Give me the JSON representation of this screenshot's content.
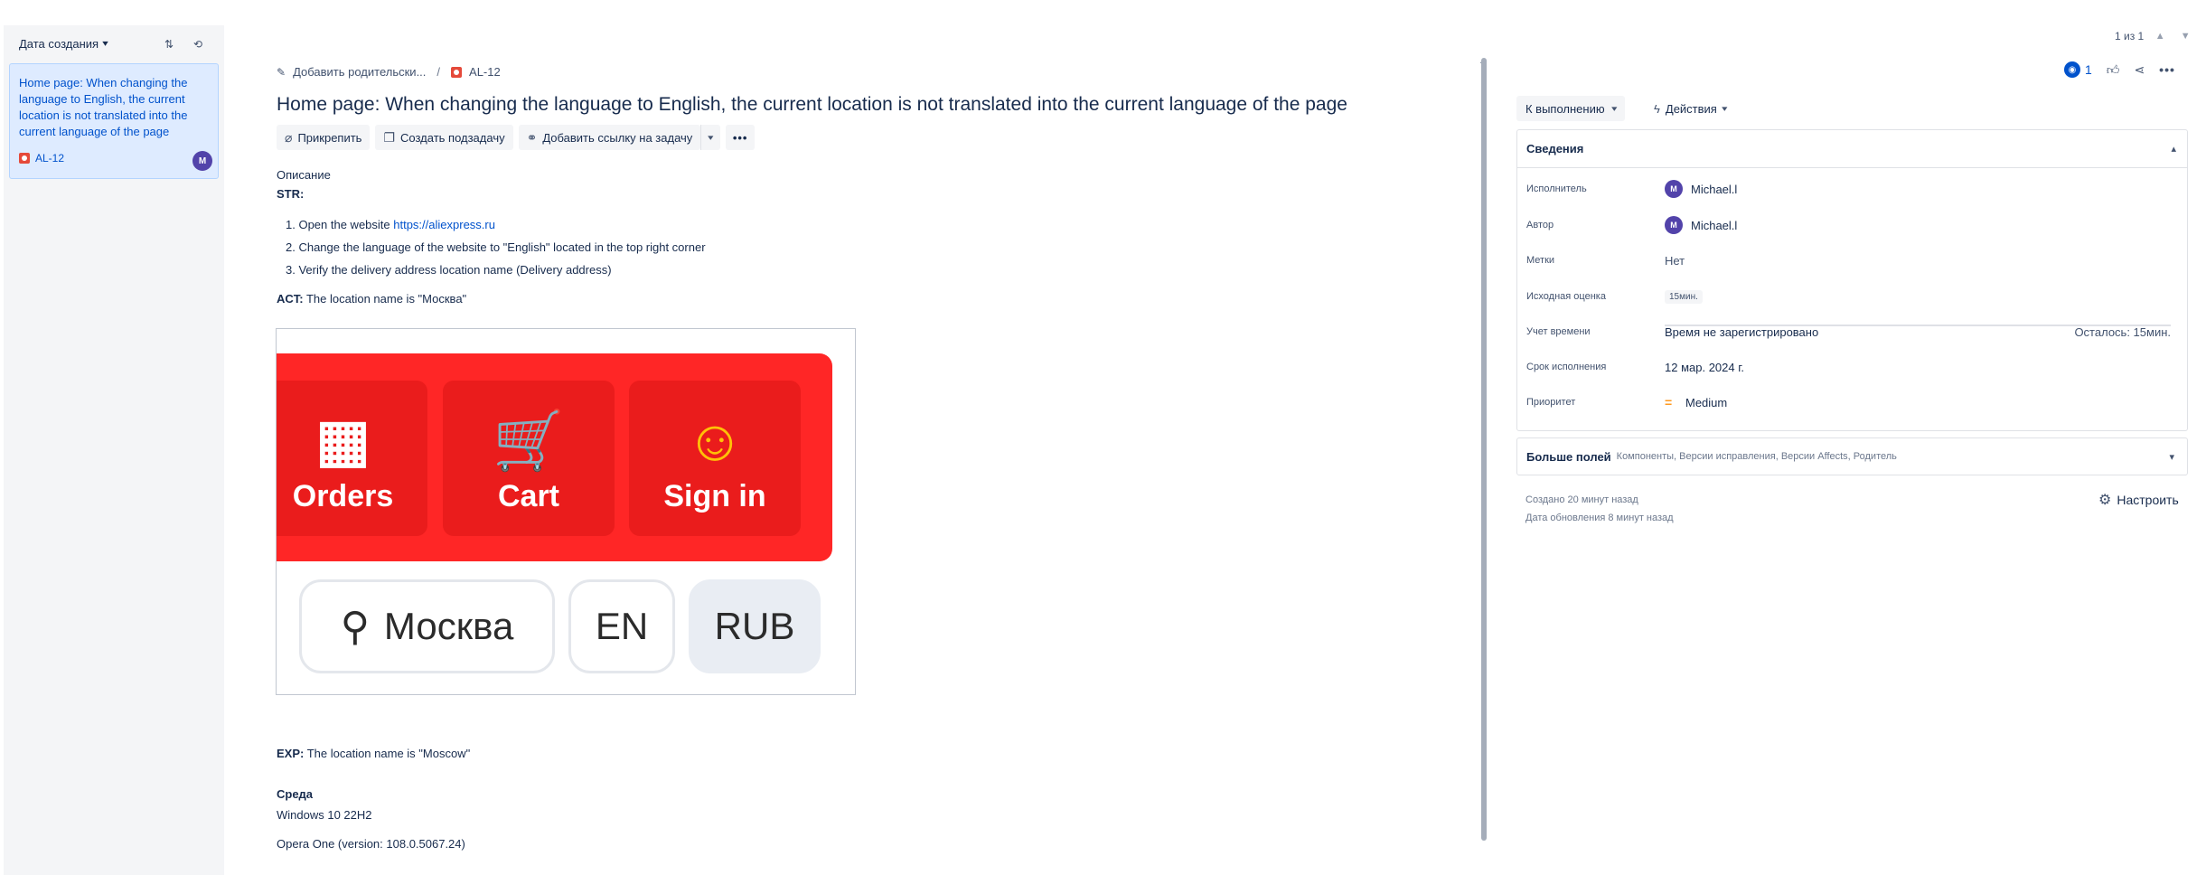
{
  "sidebar": {
    "sort_label": "Дата создания",
    "sort_order_icon": "sort-order-icon",
    "refresh_icon": "refresh-icon",
    "items": [
      {
        "title": "Home page: When changing the language to English, the current location is not translated into the current language of the page",
        "key": "AL-12",
        "avatar": "M"
      }
    ]
  },
  "breadcrumb": {
    "add_parent": "Добавить родительски...",
    "separator": "/",
    "issue_key": "AL-12"
  },
  "issue": {
    "title": "Home page: When changing the language to English, the current location is not translated into the current language of the page"
  },
  "toolbar": {
    "attach": "Прикрепить",
    "create_subtask": "Создать подзадачу",
    "add_link": "Добавить ссылку на задачу",
    "more": "•••"
  },
  "description": {
    "label": "Описание",
    "str": "STR:",
    "steps": [
      {
        "prefix": "1. Open the website ",
        "link": "https://aliexpress.ru",
        "suffix": ""
      },
      {
        "prefix": "2. Change the language of the website to \"English\" located in the top right corner",
        "link": "",
        "suffix": ""
      },
      {
        "prefix": "3. Verify the delivery address location name (Delivery address)",
        "link": "",
        "suffix": ""
      }
    ],
    "act_label": "ACT:",
    "act_text": " The location name is \"Москва\"",
    "exp_label": "EXP:",
    "exp_text": " The location name is \"Moscow\"",
    "env_label": "Среда",
    "env_os": "Windows 10 22H2",
    "env_browser": "Opera One (version: 108.0.5067.24)"
  },
  "attachment": {
    "tiles": [
      "Orders",
      "Cart",
      "Sign in"
    ],
    "city": "Москва",
    "lang": "EN",
    "currency": "RUB",
    "banner_color": "#ff2626"
  },
  "pager": {
    "text": "1 из 1"
  },
  "header_actions": {
    "watchers": "1"
  },
  "status": {
    "label": "К выполнению",
    "actions": "Действия"
  },
  "details": {
    "heading": "Сведения",
    "fields": {
      "assignee_label": "Исполнитель",
      "assignee_value": "Michael.l",
      "reporter_label": "Автор",
      "reporter_value": "Michael.l",
      "labels_label": "Метки",
      "labels_value": "Нет",
      "estimate_label": "Исходная оценка",
      "estimate_value": "15мин.",
      "time_label": "Учет времени",
      "time_value": "Время не зарегистрировано",
      "time_remaining": "Осталось: 15мин.",
      "due_label": "Срок исполнения",
      "due_value": "12 мар. 2024 г.",
      "priority_label": "Приоритет",
      "priority_value": "Medium"
    },
    "avatar": "M"
  },
  "more_fields": {
    "title": "Больше полей",
    "subtitle": "Компоненты, Версии исправления, Версии Affects, Родитель"
  },
  "meta": {
    "created": "Создано 20 минут назад",
    "updated": "Дата обновления 8 минут назад",
    "configure": "Настроить"
  },
  "colors": {
    "accent": "#0052cc",
    "bug": "#e5493a",
    "avatar": "#5243aa",
    "priority_medium": "#ff991f"
  }
}
